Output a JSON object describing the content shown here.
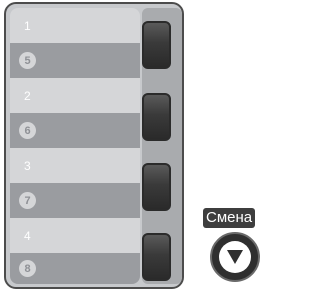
{
  "speed_dial": {
    "entries": [
      {
        "top": "1",
        "bottom": "5"
      },
      {
        "top": "2",
        "bottom": "6"
      },
      {
        "top": "3",
        "bottom": "7"
      },
      {
        "top": "4",
        "bottom": "8"
      }
    ]
  },
  "shift": {
    "label": "Смена",
    "icon": "triangle-down-icon"
  }
}
